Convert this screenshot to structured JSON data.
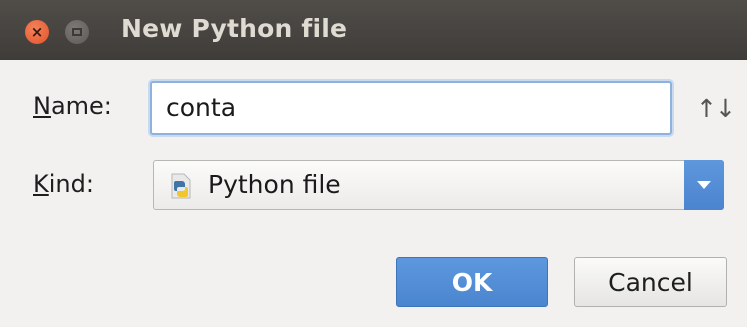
{
  "window": {
    "title": "New Python file",
    "close_symbol": "×"
  },
  "form": {
    "name_label_mnemonic": "N",
    "name_label_rest": "ame:",
    "name_value": "conta",
    "sort_icon": "↑↓",
    "kind_label_mnemonic": "K",
    "kind_label_rest": "ind:",
    "kind_value": "Python file",
    "kind_icon": "python-file-icon"
  },
  "buttons": {
    "ok_label": "OK",
    "cancel_label": "Cancel"
  },
  "colors": {
    "titlebar": "#45423f",
    "accent": "#4f8ad3",
    "close_button": "#e8602f"
  }
}
